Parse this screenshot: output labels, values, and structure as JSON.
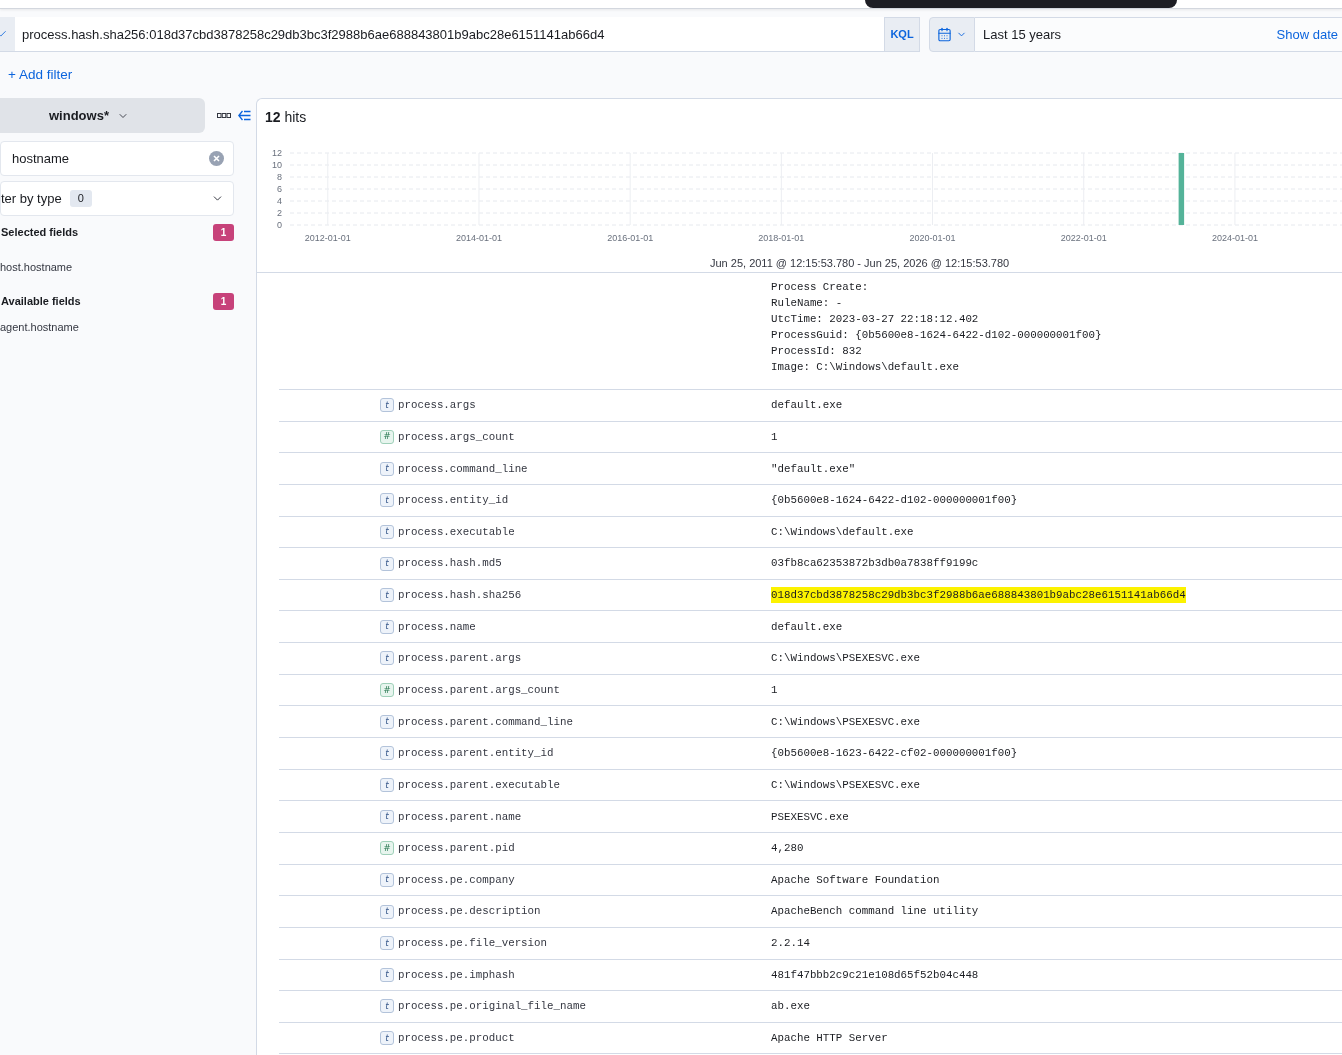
{
  "query_bar": {
    "query": "process.hash.sha256:018d37cbd3878258c29db3bc3f2988b6ae688843801b9abc28e6151141ab66d4",
    "language_button": "KQL",
    "date_range": "Last 15 years",
    "show_dates_link": "Show date"
  },
  "filter_bar": {
    "add_filter": "+ Add filter"
  },
  "sidebar": {
    "data_view": "windows*",
    "field_search": {
      "value": "hostname"
    },
    "type_filter": {
      "label": "ter by type",
      "count": "0"
    },
    "sections": [
      {
        "title": "Selected fields",
        "count": "1",
        "fields": [
          "host.hostname"
        ]
      },
      {
        "title": "Available fields",
        "count": "1",
        "fields": [
          "agent.hostname"
        ]
      }
    ]
  },
  "results": {
    "hits": "**12** hits",
    "chart_data": {
      "type": "bar",
      "grid": true,
      "categories": [
        null,
        null,
        null,
        null,
        null,
        null,
        "2012-01-01",
        null,
        null,
        null,
        null,
        null,
        null,
        null,
        null,
        null,
        null,
        null,
        null,
        null,
        null,
        null,
        null,
        null,
        null,
        null,
        null,
        null,
        null,
        null,
        "2014-01-01",
        null,
        null,
        null,
        null,
        null,
        null,
        null,
        null,
        null,
        null,
        null,
        null,
        null,
        null,
        null,
        null,
        null,
        null,
        null,
        null,
        null,
        null,
        null,
        "2016-01-01",
        null,
        null,
        null,
        null,
        null,
        null,
        null,
        null,
        null,
        null,
        null,
        null,
        null,
        null,
        null,
        null,
        null,
        null,
        null,
        null,
        null,
        null,
        null,
        "2018-01-01",
        null,
        null,
        null,
        null,
        null,
        null,
        null,
        null,
        null,
        null,
        null,
        null,
        null,
        null,
        null,
        null,
        null,
        null,
        null,
        null,
        null,
        null,
        null,
        "2020-01-01",
        null,
        null,
        null,
        null,
        null,
        null,
        null,
        null,
        null,
        null,
        null,
        null,
        null,
        null,
        null,
        null,
        null,
        null,
        null,
        null,
        null,
        null,
        null,
        "2022-01-01",
        null,
        null,
        null,
        null,
        null,
        null,
        null,
        null,
        null,
        null,
        null,
        null,
        null,
        null,
        null,
        null,
        null,
        null,
        null,
        null,
        null,
        null,
        null,
        "2024-01-01",
        null,
        null,
        null,
        null,
        null,
        null,
        null,
        null,
        null,
        null,
        null,
        null,
        null,
        null,
        null,
        null
      ],
      "values": [
        0,
        0,
        0,
        0,
        0,
        0,
        0,
        0,
        0,
        0,
        0,
        0,
        0,
        0,
        0,
        0,
        0,
        0,
        0,
        0,
        0,
        0,
        0,
        0,
        0,
        0,
        0,
        0,
        0,
        0,
        0,
        0,
        0,
        0,
        0,
        0,
        0,
        0,
        0,
        0,
        0,
        0,
        0,
        0,
        0,
        0,
        0,
        0,
        0,
        0,
        0,
        0,
        0,
        0,
        0,
        0,
        0,
        0,
        0,
        0,
        0,
        0,
        0,
        0,
        0,
        0,
        0,
        0,
        0,
        0,
        0,
        0,
        0,
        0,
        0,
        0,
        0,
        0,
        0,
        0,
        0,
        0,
        0,
        0,
        0,
        0,
        0,
        0,
        0,
        0,
        0,
        0,
        0,
        0,
        0,
        0,
        0,
        0,
        0,
        0,
        0,
        0,
        0,
        0,
        0,
        0,
        0,
        0,
        0,
        0,
        0,
        0,
        0,
        0,
        0,
        0,
        0,
        0,
        0,
        0,
        0,
        0,
        0,
        0,
        0,
        0,
        0,
        0,
        0,
        0,
        0,
        0,
        0,
        0,
        0,
        0,
        0,
        0,
        0,
        0,
        0,
        12,
        0,
        0,
        0,
        0,
        0,
        0,
        0,
        0,
        0,
        0,
        0,
        0,
        0,
        0,
        0,
        0,
        0,
        0,
        0,
        0,
        0,
        0,
        0,
        0,
        0
      ],
      "ylim": [
        0,
        12
      ],
      "yticks": [
        0,
        2,
        4,
        6,
        8,
        10,
        12
      ]
    },
    "time_range": "Jun 25, 2011 @ 12:15:53.780 - Jun 25, 2026 @ 12:15:53.780"
  },
  "document": {
    "message_lines": [
      "Process Create:",
      "RuleName: -",
      "UtcTime: 2023-03-27 22:18:12.402",
      "ProcessGuid: {0b5600e8-1624-6422-d102-000000001f00}",
      "ProcessId: 832",
      "Image: C:\\Windows\\default.exe"
    ],
    "fields": [
      {
        "kind": "string",
        "token": "t",
        "name": "process.args",
        "value": "default.exe",
        "highlighted": false
      },
      {
        "kind": "number",
        "token": "#",
        "name": "process.args_count",
        "value": "1",
        "highlighted": false
      },
      {
        "kind": "string",
        "token": "t",
        "name": "process.command_line",
        "value": "\"default.exe\"",
        "highlighted": false
      },
      {
        "kind": "string",
        "token": "t",
        "name": "process.entity_id",
        "value": "{0b5600e8-1624-6422-d102-000000001f00}",
        "highlighted": false
      },
      {
        "kind": "string",
        "token": "t",
        "name": "process.executable",
        "value": "C:\\Windows\\default.exe",
        "highlighted": false
      },
      {
        "kind": "string",
        "token": "t",
        "name": "process.hash.md5",
        "value": "03fb8ca62353872b3db0a7838ff9199c",
        "highlighted": false
      },
      {
        "kind": "string",
        "token": "t",
        "name": "process.hash.sha256",
        "value": "018d37cbd3878258c29db3bc3f2988b6ae688843801b9abc28e6151141ab66d4",
        "highlighted": true
      },
      {
        "kind": "string",
        "token": "t",
        "name": "process.name",
        "value": "default.exe",
        "highlighted": false
      },
      {
        "kind": "string",
        "token": "t",
        "name": "process.parent.args",
        "value": "C:\\Windows\\PSEXESVC.exe",
        "highlighted": false
      },
      {
        "kind": "number",
        "token": "#",
        "name": "process.parent.args_count",
        "value": "1",
        "highlighted": false
      },
      {
        "kind": "string",
        "token": "t",
        "name": "process.parent.command_line",
        "value": "C:\\Windows\\PSEXESVC.exe",
        "highlighted": false
      },
      {
        "kind": "string",
        "token": "t",
        "name": "process.parent.entity_id",
        "value": "{0b5600e8-1623-6422-cf02-000000001f00}",
        "highlighted": false
      },
      {
        "kind": "string",
        "token": "t",
        "name": "process.parent.executable",
        "value": "C:\\Windows\\PSEXESVC.exe",
        "highlighted": false
      },
      {
        "kind": "string",
        "token": "t",
        "name": "process.parent.name",
        "value": "PSEXESVC.exe",
        "highlighted": false
      },
      {
        "kind": "number",
        "token": "#",
        "name": "process.parent.pid",
        "value": "4,280",
        "highlighted": false
      },
      {
        "kind": "string",
        "token": "t",
        "name": "process.pe.company",
        "value": "Apache Software Foundation",
        "highlighted": false
      },
      {
        "kind": "string",
        "token": "t",
        "name": "process.pe.description",
        "value": "ApacheBench command line utility",
        "highlighted": false
      },
      {
        "kind": "string",
        "token": "t",
        "name": "process.pe.file_version",
        "value": "2.2.14",
        "highlighted": false
      },
      {
        "kind": "string",
        "token": "t",
        "name": "process.pe.imphash",
        "value": "481f47bbb2c9c21e108d65f52b04c448",
        "highlighted": false
      },
      {
        "kind": "string",
        "token": "t",
        "name": "process.pe.original_file_name",
        "value": "ab.exe",
        "highlighted": false
      },
      {
        "kind": "string",
        "token": "t",
        "name": "process.pe.product",
        "value": "Apache HTTP Server",
        "highlighted": false
      }
    ]
  }
}
